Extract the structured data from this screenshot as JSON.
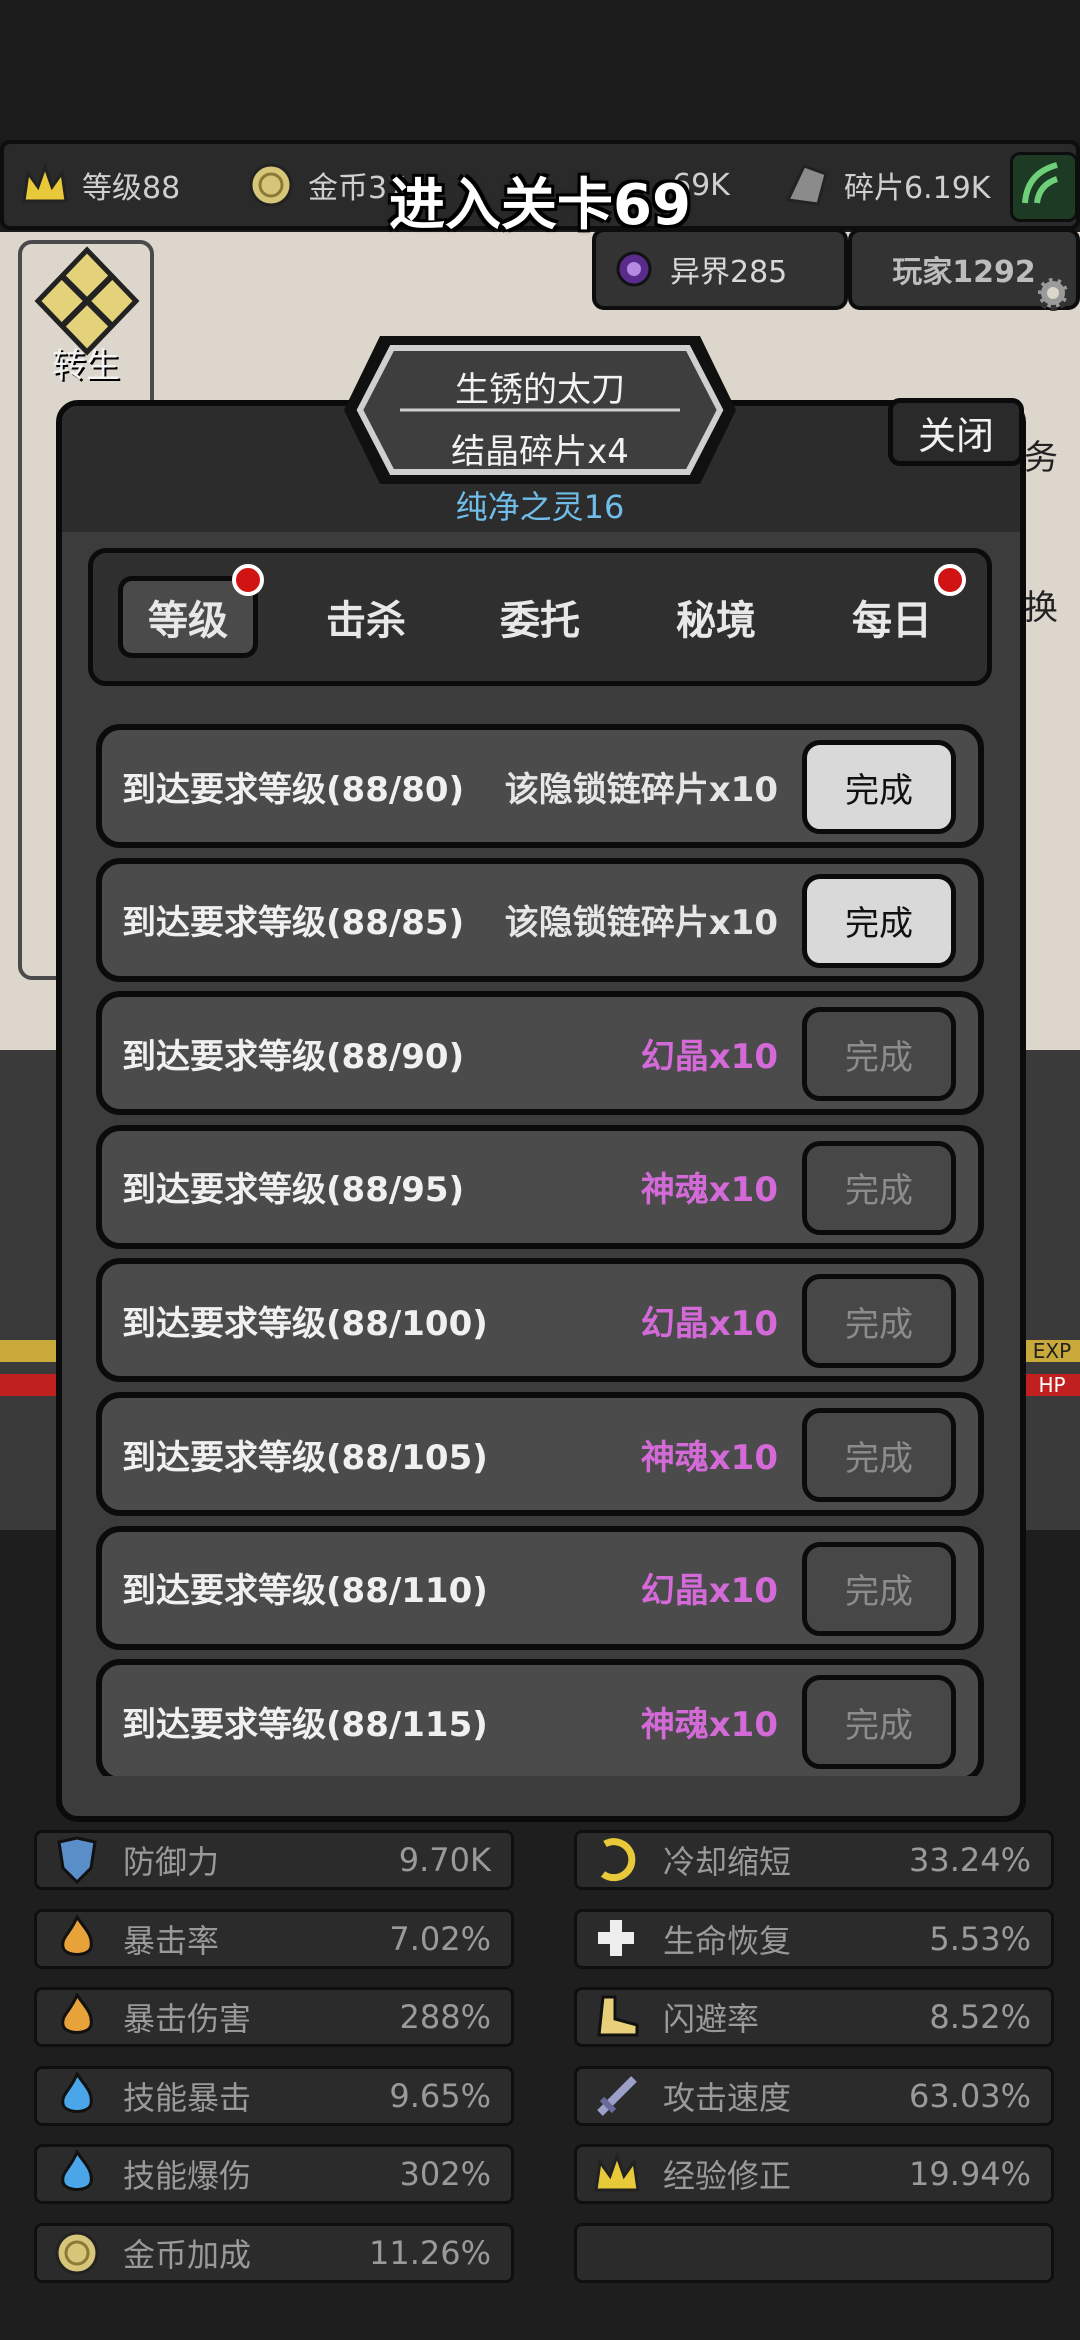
{
  "stage_title": "进入关卡69",
  "stats": [
    {
      "icon": "crown-icon",
      "label": "等级88"
    },
    {
      "icon": "coin-icon",
      "label": "金币37"
    },
    {
      "icon": "gem-icon",
      "label": "69K"
    },
    {
      "icon": "shard-icon",
      "label": "碎片6.19K"
    }
  ],
  "sub": {
    "otherworld": "异界285",
    "players": "玩家1292",
    "rebirth": "转生"
  },
  "modal": {
    "item_name": "生锈的太刀",
    "item_reward": "结晶碎片x4",
    "purity": "纯净之灵16",
    "close_label": "关闭",
    "tabs": [
      {
        "label": "等级",
        "active": true,
        "dot": true
      },
      {
        "label": "击杀",
        "active": false,
        "dot": false
      },
      {
        "label": "委托",
        "active": false,
        "dot": false
      },
      {
        "label": "秘境",
        "active": false,
        "dot": false
      },
      {
        "label": "每日",
        "active": false,
        "dot": true
      }
    ]
  },
  "quests": [
    {
      "req": "到达要求等级(88/80)",
      "reward": "该隐锁链碎片x10",
      "reward_color": "#e6e6e6",
      "button": "完成",
      "enabled": true
    },
    {
      "req": "到达要求等级(88/85)",
      "reward": "该隐锁链碎片x10",
      "reward_color": "#e6e6e6",
      "button": "完成",
      "enabled": true
    },
    {
      "req": "到达要求等级(88/90)",
      "reward": "幻晶x10",
      "reward_color": "#d36ad8",
      "button": "完成",
      "enabled": false
    },
    {
      "req": "到达要求等级(88/95)",
      "reward": "神魂x10",
      "reward_color": "#d36ad8",
      "button": "完成",
      "enabled": false
    },
    {
      "req": "到达要求等级(88/100)",
      "reward": "幻晶x10",
      "reward_color": "#d36ad8",
      "button": "完成",
      "enabled": false
    },
    {
      "req": "到达要求等级(88/105)",
      "reward": "神魂x10",
      "reward_color": "#d36ad8",
      "button": "完成",
      "enabled": false
    },
    {
      "req": "到达要求等级(88/110)",
      "reward": "幻晶x10",
      "reward_color": "#d36ad8",
      "button": "完成",
      "enabled": false
    },
    {
      "req": "到达要求等级(88/115)",
      "reward": "神魂x10",
      "reward_color": "#d36ad8",
      "button": "完成",
      "enabled": false
    }
  ],
  "attributes_left": [
    {
      "icon": "shield-icon",
      "label": "防御力",
      "value": "9.70K"
    },
    {
      "icon": "flame-icon",
      "label": "暴击率",
      "value": "7.02%"
    },
    {
      "icon": "flame-icon",
      "label": "暴击伤害",
      "value": "288%"
    },
    {
      "icon": "blue-flame-icon",
      "label": "技能暴击",
      "value": "9.65%"
    },
    {
      "icon": "blue-flame-icon",
      "label": "技能爆伤",
      "value": "302%"
    },
    {
      "icon": "coin-icon",
      "label": "金币加成",
      "value": "11.26%"
    }
  ],
  "attributes_right": [
    {
      "icon": "cooldown-icon",
      "label": "冷却缩短",
      "value": "33.24%"
    },
    {
      "icon": "heal-plus-icon",
      "label": "生命恢复",
      "value": "5.53%"
    },
    {
      "icon": "boot-icon",
      "label": "闪避率",
      "value": "8.52%"
    },
    {
      "icon": "sword-icon",
      "label": "攻击速度",
      "value": "63.03%"
    },
    {
      "icon": "crown-icon",
      "label": "经验修正",
      "value": "19.94%"
    }
  ],
  "side_labels": {
    "exp": "EXP",
    "hp": "HP",
    "task_frag": "务",
    "swap_frag": "换"
  }
}
